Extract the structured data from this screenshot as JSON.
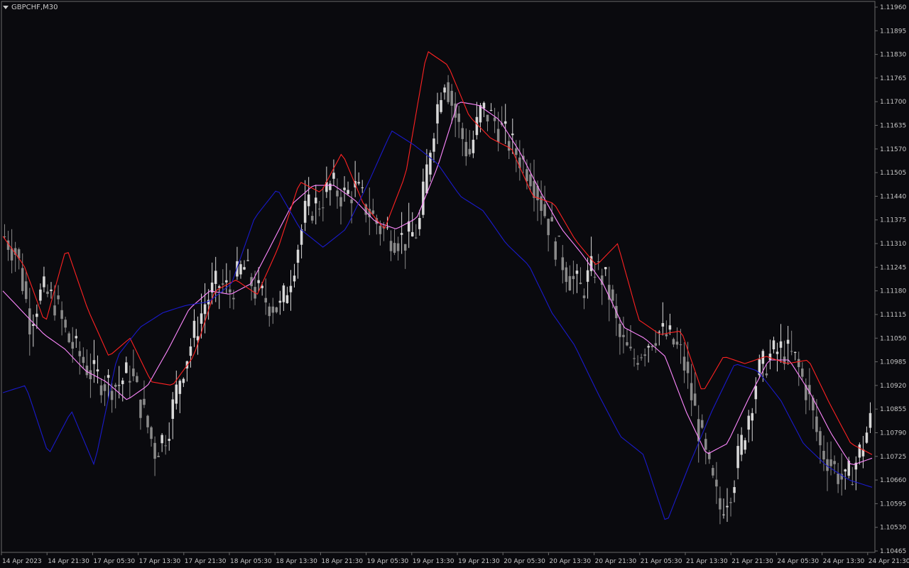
{
  "window": {
    "symbol": "GBPCHF,M30"
  },
  "chart_data": {
    "type": "candlestick",
    "symbol": "GBPCHF",
    "timeframe": "M30",
    "ylim": [
      1.10465,
      1.1196
    ],
    "y_ticks": [
      "1.11960",
      "1.11895",
      "1.11830",
      "1.11765",
      "1.11700",
      "1.11635",
      "1.11570",
      "1.11505",
      "1.11440",
      "1.11375",
      "1.11310",
      "1.11245",
      "1.11180",
      "1.11115",
      "1.11050",
      "1.10985",
      "1.10920",
      "1.10855",
      "1.10790",
      "1.10725",
      "1.10660",
      "1.10595",
      "1.10530",
      "1.10465"
    ],
    "x_ticks": [
      "14 Apr 2023",
      "14 Apr 21:30",
      "17 Apr 05:30",
      "17 Apr 13:30",
      "17 Apr 21:30",
      "18 Apr 05:30",
      "18 Apr 13:30",
      "18 Apr 21:30",
      "19 Apr 05:30",
      "19 Apr 13:30",
      "19 Apr 21:30",
      "20 Apr 05:30",
      "20 Apr 13:30",
      "20 Apr 21:30",
      "21 Apr 05:30",
      "21 Apr 13:30",
      "21 Apr 21:30",
      "24 Apr 05:30",
      "24 Apr 13:30",
      "24 Apr 21:30"
    ],
    "close_path": [
      [
        1.1133,
        1.1128,
        1.111,
        1.1118,
        1.1115,
        1.1105,
        1.11,
        1.1095,
        1.1093,
        1.1092,
        1.1096,
        1.1085,
        1.1074,
        1.108,
        1.1095,
        1.1105,
        1.1115,
        1.112,
        1.1118,
        1.1125,
        1.1118,
        1.1115,
        1.1113,
        1.1125,
        1.114,
        1.1142,
        1.1147,
        1.1144,
        1.1146,
        1.114,
        1.1135,
        1.1133,
        1.1132,
        1.1135,
        1.116,
        1.1178,
        1.1165,
        1.1155,
        1.1168,
        1.1165,
        1.116,
        1.1155,
        1.115,
        1.114,
        1.113,
        1.1122,
        1.1118,
        1.1125,
        1.112,
        1.1105,
        1.1099,
        1.1103,
        1.1107,
        1.1105,
        1.11,
        1.1085,
        1.107,
        1.1058,
        1.1065,
        1.108,
        1.1095,
        1.11,
        1.1102,
        1.1099,
        1.109,
        1.1075,
        1.107,
        1.1065,
        1.1072,
        1.1082
      ]
    ],
    "series": [
      {
        "indicator": "moving average",
        "color": "#ff88ff",
        "values": [
          1.1118,
          1.1112,
          1.1106,
          1.1102,
          1.1096,
          1.1093,
          1.1088,
          1.1092,
          1.1102,
          1.1113,
          1.1118,
          1.1117,
          1.112,
          1.1131,
          1.1142,
          1.1147,
          1.1147,
          1.1143,
          1.1137,
          1.1135,
          1.1138,
          1.1152,
          1.117,
          1.1169,
          1.1165,
          1.1156,
          1.1145,
          1.1135,
          1.1128,
          1.112,
          1.1108,
          1.1105,
          1.11,
          1.1085,
          1.1073,
          1.1076,
          1.1088,
          1.1099,
          1.1099,
          1.109,
          1.1079,
          1.107,
          1.1072
        ]
      },
      {
        "indicator": "upper band",
        "color": "#ff2222",
        "values": [
          1.1133,
          1.1125,
          1.1109,
          1.113,
          1.1113,
          1.11,
          1.1105,
          1.1093,
          1.1092,
          1.11,
          1.1118,
          1.1121,
          1.1117,
          1.113,
          1.1148,
          1.1145,
          1.1156,
          1.1142,
          1.1135,
          1.115,
          1.1184,
          1.118,
          1.1166,
          1.116,
          1.1157,
          1.1144,
          1.1142,
          1.1132,
          1.1125,
          1.1131,
          1.111,
          1.1106,
          1.1107,
          1.109,
          1.11,
          1.1098,
          1.11,
          1.1098,
          1.1099,
          1.1087,
          1.1076,
          1.1073
        ]
      },
      {
        "indicator": "lower band",
        "color": "#1a1acc",
        "values": [
          1.109,
          1.1092,
          1.1073,
          1.1085,
          1.107,
          1.11,
          1.1108,
          1.1112,
          1.1114,
          1.1115,
          1.112,
          1.1138,
          1.1146,
          1.1135,
          1.113,
          1.1135,
          1.1148,
          1.1162,
          1.1158,
          1.1153,
          1.1144,
          1.114,
          1.1131,
          1.1125,
          1.1112,
          1.1103,
          1.109,
          1.1078,
          1.1073,
          1.1054,
          1.107,
          1.1085,
          1.1098,
          1.1096,
          1.1088,
          1.1076,
          1.107,
          1.1066,
          1.1064
        ]
      }
    ],
    "grid": false
  }
}
